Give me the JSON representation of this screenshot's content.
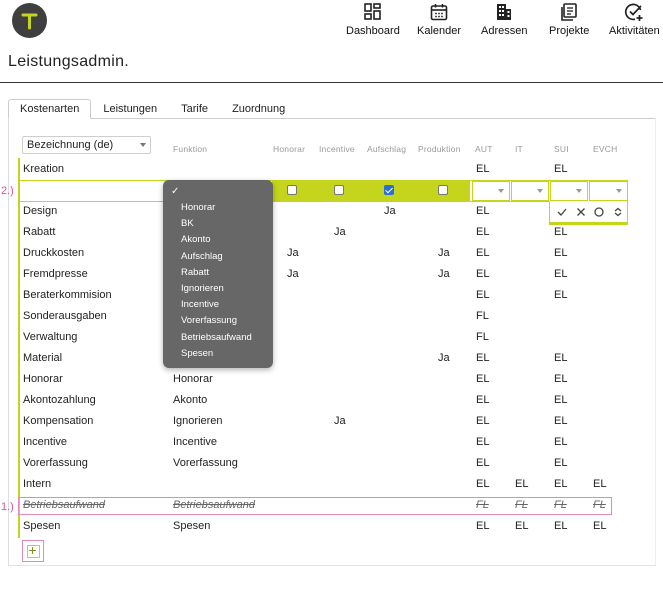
{
  "app": {
    "logo_letter": "T"
  },
  "nav": [
    {
      "label": "Dashboard",
      "icon": "dashboard-icon"
    },
    {
      "label": "Kalender",
      "icon": "calendar-icon"
    },
    {
      "label": "Adressen",
      "icon": "building-icon"
    },
    {
      "label": "Projekte",
      "icon": "projects-icon"
    },
    {
      "label": "Aktivitäten",
      "icon": "activity-check-icon"
    }
  ],
  "page": {
    "title": "Leistungsadmin."
  },
  "tabs": [
    {
      "label": "Kostenarten",
      "active": true
    },
    {
      "label": "Leistungen"
    },
    {
      "label": "Tarife"
    },
    {
      "label": "Zuordnung"
    }
  ],
  "filter": {
    "selected": "Bezeichnung (de)"
  },
  "columns": [
    "Funktion",
    "Honorar",
    "Incentive",
    "Aufschlag",
    "Produktion",
    "AUT",
    "IT",
    "SUI",
    "EVCH"
  ],
  "markers": {
    "edit": "2.)",
    "highlight": "1.)"
  },
  "rows": [
    {
      "name": "Kreation",
      "funktion": "",
      "honorar": "",
      "incentive": "",
      "aufschlag": "",
      "produktion": "",
      "aut": "EL",
      "it": "",
      "sui": "EL",
      "evch": ""
    },
    {
      "name": "Design",
      "funktion": "",
      "honorar": "",
      "incentive": "",
      "aufschlag": "Ja",
      "produktion": "",
      "aut": "EL",
      "it": "",
      "sui": "",
      "evch": ""
    },
    {
      "name": "Rabatt",
      "funktion": "",
      "honorar": "",
      "incentive": "Ja",
      "aufschlag": "",
      "produktion": "",
      "aut": "EL",
      "it": "",
      "sui": "EL",
      "evch": ""
    },
    {
      "name": "Druckkosten",
      "funktion": "",
      "honorar": "Ja",
      "incentive": "",
      "aufschlag": "",
      "produktion": "Ja",
      "aut": "EL",
      "it": "",
      "sui": "EL",
      "evch": ""
    },
    {
      "name": "Fremdpresse",
      "funktion": "",
      "honorar": "Ja",
      "incentive": "",
      "aufschlag": "",
      "produktion": "Ja",
      "aut": "EL",
      "it": "",
      "sui": "EL",
      "evch": ""
    },
    {
      "name": "Beraterkommision",
      "funktion": "",
      "honorar": "",
      "incentive": "",
      "aufschlag": "",
      "produktion": "",
      "aut": "EL",
      "it": "",
      "sui": "EL",
      "evch": ""
    },
    {
      "name": "Sonderausgaben",
      "funktion": "",
      "honorar": "",
      "incentive": "",
      "aufschlag": "",
      "produktion": "",
      "aut": "FL",
      "it": "",
      "sui": "",
      "evch": ""
    },
    {
      "name": "Verwaltung",
      "funktion": "",
      "honorar": "",
      "incentive": "",
      "aufschlag": "",
      "produktion": "",
      "aut": "FL",
      "it": "",
      "sui": "",
      "evch": ""
    },
    {
      "name": "Material",
      "funktion": "",
      "honorar": "",
      "incentive": "",
      "aufschlag": "",
      "produktion": "Ja",
      "aut": "EL",
      "it": "",
      "sui": "EL",
      "evch": ""
    },
    {
      "name": "Honorar",
      "funktion": "Honorar",
      "honorar": "",
      "incentive": "",
      "aufschlag": "",
      "produktion": "",
      "aut": "EL",
      "it": "",
      "sui": "EL",
      "evch": ""
    },
    {
      "name": "Akontozahlung",
      "funktion": "Akonto",
      "honorar": "",
      "incentive": "",
      "aufschlag": "",
      "produktion": "",
      "aut": "EL",
      "it": "",
      "sui": "EL",
      "evch": ""
    },
    {
      "name": "Kompensation",
      "funktion": "Ignorieren",
      "honorar": "",
      "incentive": "Ja",
      "aufschlag": "",
      "produktion": "",
      "aut": "EL",
      "it": "",
      "sui": "EL",
      "evch": ""
    },
    {
      "name": "Incentive",
      "funktion": "Incentive",
      "honorar": "",
      "incentive": "",
      "aufschlag": "",
      "produktion": "",
      "aut": "EL",
      "it": "",
      "sui": "EL",
      "evch": ""
    },
    {
      "name": "Vorerfassung",
      "funktion": "Vorerfassung",
      "honorar": "",
      "incentive": "",
      "aufschlag": "",
      "produktion": "",
      "aut": "EL",
      "it": "",
      "sui": "EL",
      "evch": ""
    },
    {
      "name": "Intern",
      "funktion": "",
      "honorar": "",
      "incentive": "",
      "aufschlag": "",
      "produktion": "",
      "aut": "EL",
      "it": "EL",
      "sui": "EL",
      "evch": "EL"
    },
    {
      "name": "Betriebsaufwand",
      "funktion": "Betriebsaufwand",
      "honorar": "",
      "incentive": "",
      "aufschlag": "",
      "produktion": "",
      "aut": "FL",
      "it": "FL",
      "sui": "FL",
      "evch": "FL",
      "deleted": true
    },
    {
      "name": "Spesen",
      "funktion": "Spesen",
      "honorar": "",
      "incentive": "",
      "aufschlag": "",
      "produktion": "",
      "aut": "EL",
      "it": "EL",
      "sui": "EL",
      "evch": "EL"
    }
  ],
  "edit_row": {
    "honorar": false,
    "incentive": false,
    "aufschlag": true,
    "produktion": false
  },
  "dropdown": {
    "selected": "",
    "options": [
      "Honorar",
      "BK",
      "Akonto",
      "Aufschlag",
      "Rabatt",
      "Ignorieren",
      "Incentive",
      "Vorerfassung",
      "Betriebsaufwand",
      "Spesen"
    ]
  },
  "colors": {
    "accent": "#c5d41c",
    "highlight": "#e58ab6",
    "dark": "#3f3f3f"
  }
}
